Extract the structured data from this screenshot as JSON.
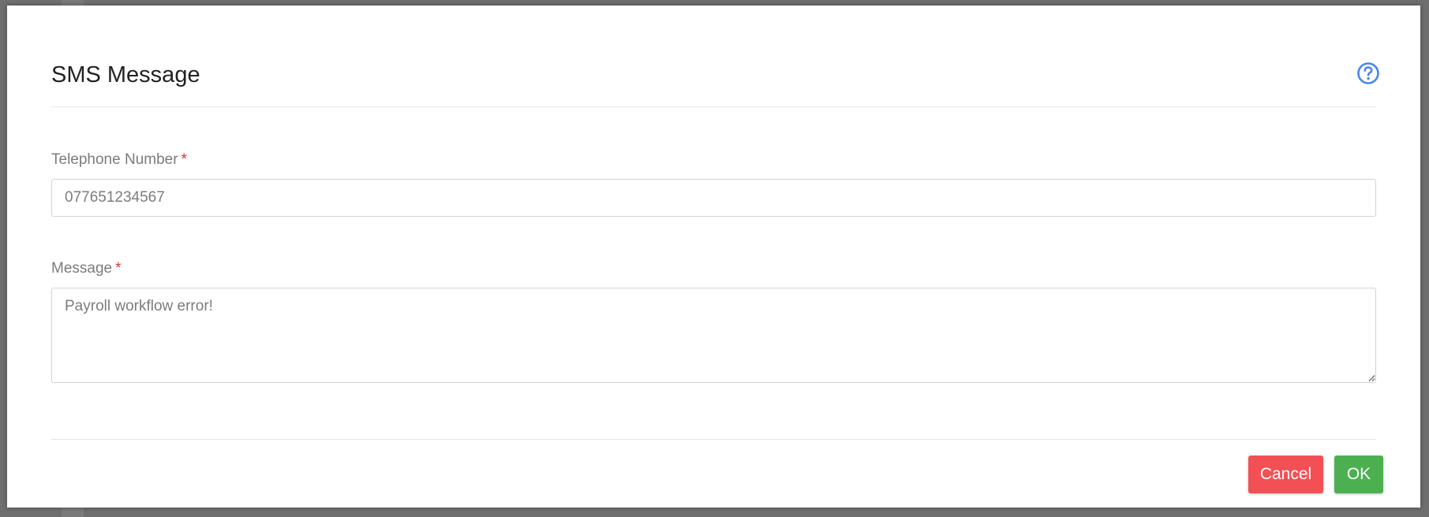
{
  "dialog": {
    "title": "SMS Message",
    "help_icon": "question-circle-icon",
    "accent_color": "#4a86e8"
  },
  "form": {
    "telephone": {
      "label": "Telephone Number",
      "required_mark": "*",
      "value": "077651234567"
    },
    "message": {
      "label": "Message",
      "required_mark": "*",
      "value": "Payroll workflow error!"
    }
  },
  "footer": {
    "cancel_label": "Cancel",
    "ok_label": "OK",
    "cancel_color": "#f25055",
    "ok_color": "#4cb051"
  }
}
